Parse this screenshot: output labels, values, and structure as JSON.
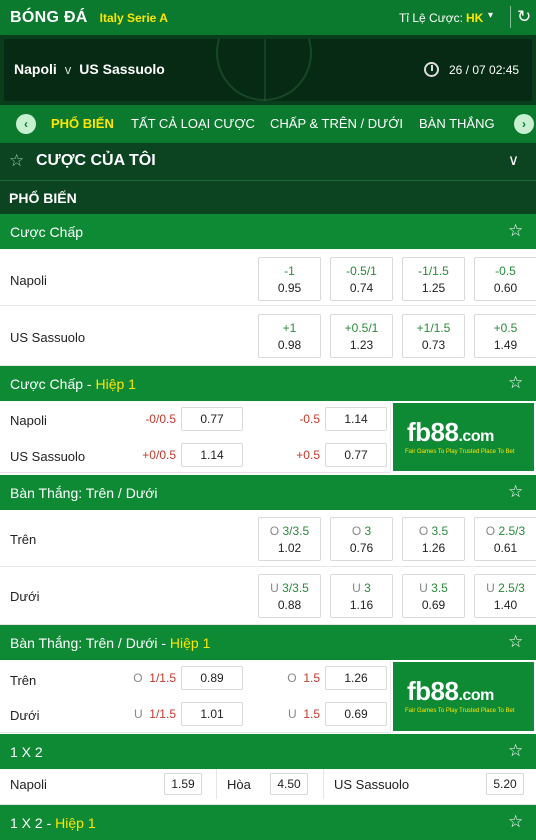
{
  "topbar": {
    "brand": "BÓNG ĐÁ",
    "league": "Italy Serie A",
    "odds_label": "Tỉ Lệ Cược:",
    "odds_format": "HK",
    "caret": "▾",
    "refresh_icon": "↻"
  },
  "match": {
    "home": "Napoli",
    "vs": "v",
    "away": "US Sassuolo",
    "datetime": "26 / 07  02:45"
  },
  "tabs": {
    "prev": "‹",
    "next": "›",
    "items": [
      {
        "label": "PHỔ BIẾN",
        "active": true
      },
      {
        "label": "TẤT CẢ LOẠI CƯỢC"
      },
      {
        "label": "CHẤP & TRÊN / DƯỚI"
      },
      {
        "label": "BÀN THẮNG"
      }
    ]
  },
  "mybets": {
    "star": "☆",
    "title": "CƯỢC CỦA TÔI",
    "chevron": "∨"
  },
  "section": {
    "title": "PHỔ BIẾN"
  },
  "fav_icon": "☆",
  "handicap": {
    "title": "Cược Chấp",
    "rows": [
      {
        "name": "Napoli",
        "cells": [
          {
            "h": "-1",
            "o": "0.95"
          },
          {
            "h": "-0.5/1",
            "o": "0.74"
          },
          {
            "h": "-1/1.5",
            "o": "1.25"
          },
          {
            "h": "-0.5",
            "o": "0.60"
          }
        ]
      },
      {
        "name": "US Sassuolo",
        "cells": [
          {
            "h": "+1",
            "o": "0.98"
          },
          {
            "h": "+0.5/1",
            "o": "1.23"
          },
          {
            "h": "+1/1.5",
            "o": "0.73"
          },
          {
            "h": "+0.5",
            "o": "1.49"
          }
        ]
      }
    ]
  },
  "handicap_h1": {
    "title": "Cược Chấp - ",
    "suffix": "Hiệp 1",
    "rows": [
      {
        "name": "Napoli",
        "h1": "-0/0.5",
        "o1": "0.77",
        "h2": "-0.5",
        "o2": "1.14"
      },
      {
        "name": "US Sassuolo",
        "h1": "+0/0.5",
        "o1": "1.14",
        "h2": "+0.5",
        "o2": "0.77"
      }
    ]
  },
  "ou": {
    "title": "Bàn Thắng: Trên / Dưới",
    "rows": [
      {
        "name": "Trên",
        "cells": [
          {
            "lbl": "O",
            "h": "3/3.5",
            "o": "1.02"
          },
          {
            "lbl": "O",
            "h": "3",
            "o": "0.76"
          },
          {
            "lbl": "O",
            "h": "3.5",
            "o": "1.26"
          },
          {
            "lbl": "O",
            "h": "2.5/3",
            "o": "0.61"
          }
        ]
      },
      {
        "name": "Dưới",
        "cells": [
          {
            "lbl": "U",
            "h": "3/3.5",
            "o": "0.88"
          },
          {
            "lbl": "U",
            "h": "3",
            "o": "1.16"
          },
          {
            "lbl": "U",
            "h": "3.5",
            "o": "0.69"
          },
          {
            "lbl": "U",
            "h": "2.5/3",
            "o": "1.40"
          }
        ]
      }
    ]
  },
  "ou_h1": {
    "title": "Bàn Thắng: Trên / Dưới - ",
    "suffix": "Hiệp 1",
    "rows": [
      {
        "name": "Trên",
        "l1": "O",
        "h1": "1/1.5",
        "o1": "0.89",
        "l2": "O",
        "h2": "1.5",
        "o2": "1.26"
      },
      {
        "name": "Dưới",
        "l1": "U",
        "h1": "1/1.5",
        "o1": "1.01",
        "l2": "U",
        "h2": "1.5",
        "o2": "0.69"
      }
    ]
  },
  "ad": {
    "logo": "fb88",
    "logo_tld": ".com",
    "tagline": "Fair Games To Play  Trusted Place To Bet"
  },
  "x12": {
    "title": "1 X 2",
    "home": "Napoli",
    "home_odds": "1.59",
    "draw": "Hòa",
    "draw_odds": "4.50",
    "away": "US Sassuolo",
    "away_odds": "5.20"
  },
  "x12_h1": {
    "title": "1 X 2 - ",
    "suffix": "Hiệp 1"
  }
}
